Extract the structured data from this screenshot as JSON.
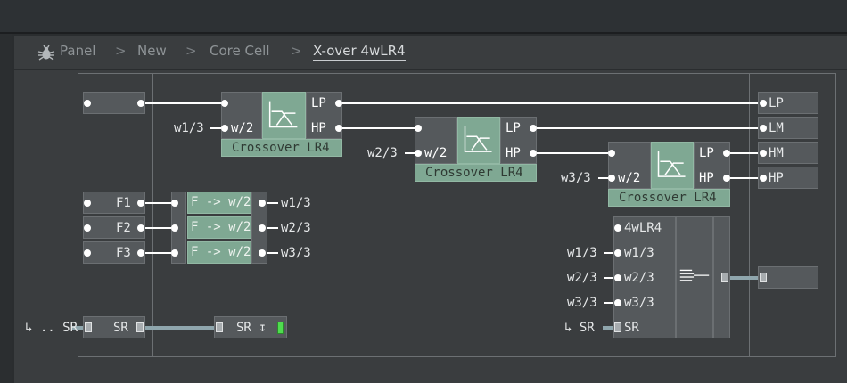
{
  "breadcrumb": {
    "items": [
      "Panel",
      "New",
      "Core Cell",
      "X-over 4wLR4"
    ],
    "separator": ">"
  },
  "crossover": {
    "title": "Crossover LR4",
    "in_port": "w/2",
    "out_lp": "LP",
    "out_hp": "HP"
  },
  "inputs": {
    "w1": "w1/3",
    "w2": "w2/3",
    "w3": "w3/3"
  },
  "outputs": [
    "LP",
    "LM",
    "HM",
    "HP"
  ],
  "freq_knobs": [
    "F1",
    "F2",
    "F3"
  ],
  "converters": {
    "label": "F -> w/2",
    "outputs": [
      "w1/3",
      "w2/3",
      "w3/3"
    ]
  },
  "sr": {
    "ext_label": "↳ .. SR",
    "box_label": "SR",
    "sr_out_label": "SR ↧",
    "ext_sr": "↳ SR"
  },
  "module4": {
    "ports": [
      "4wLR4",
      "w1/3",
      "w2/3",
      "w3/3",
      "SR"
    ]
  },
  "colors": {
    "accent_green": "#7fa893",
    "wire": "#ffffff",
    "bus_wire": "#8fa6ad",
    "led": "#4fdc4f"
  },
  "icons": [
    "bug-icon",
    "merge-bus-icon",
    "crossover-filter-icon"
  ]
}
